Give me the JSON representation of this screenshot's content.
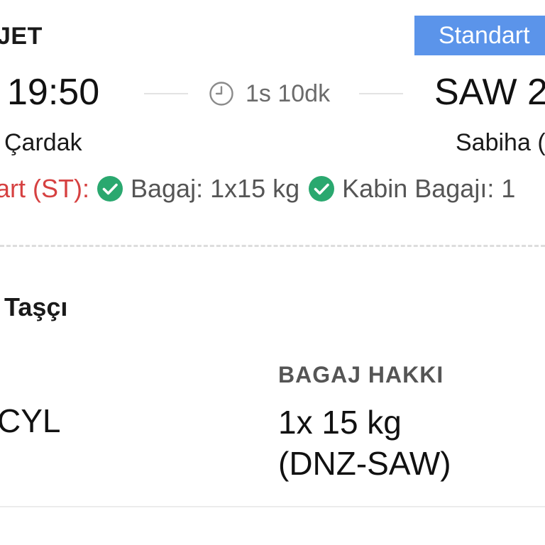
{
  "flight": {
    "airline": "JET",
    "fare_badge": "Standart",
    "departure_time": "19:50",
    "arrival_code": "SAW 2",
    "duration": "1s 10dk",
    "departure_city": "Çardak",
    "arrival_city": "Sabiha (",
    "fare_class": "art (ST):",
    "features": [
      "Bagaj: 1x15 kg",
      "Kabin Bagajı: 1"
    ]
  },
  "passenger": {
    "name": "Taşçı",
    "left_value": "CYL",
    "baggage_title": "BAGAJ HAKKI",
    "baggage_line1": "1x 15 kg",
    "baggage_line2": "(DNZ-SAW)"
  },
  "colors": {
    "badge": "#5b94ea",
    "fare_class": "#d64141",
    "check": "#2aa86f"
  },
  "icons": {
    "clock": "clock-icon",
    "check": "check-circle-icon"
  }
}
